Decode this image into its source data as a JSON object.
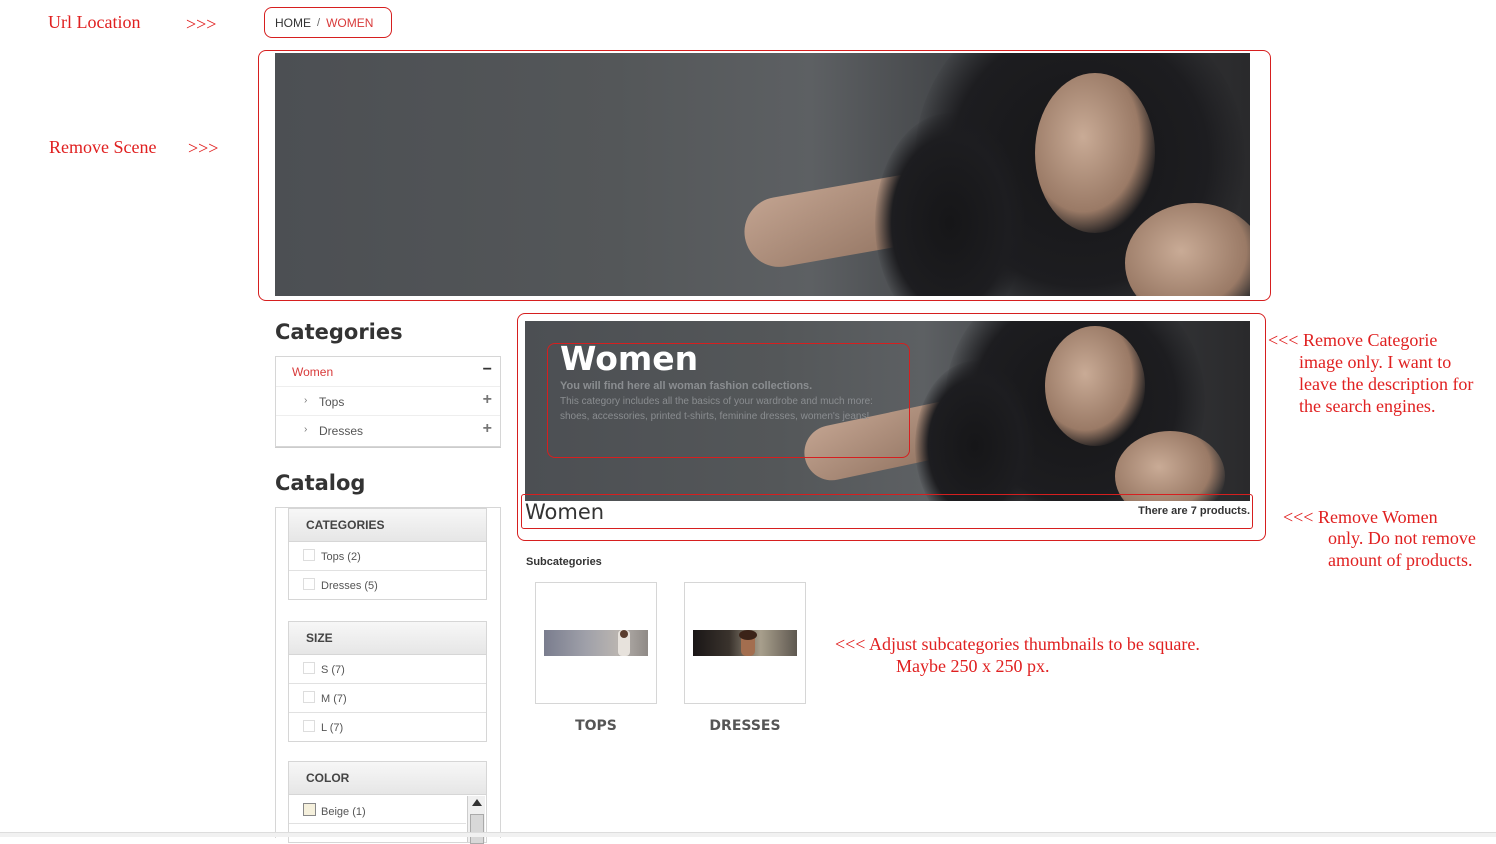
{
  "annotations": {
    "url_location": "Url Location",
    "url_arrow": ">>>",
    "remove_scene": "Remove Scene",
    "scene_arrow": ">>>",
    "remove_category_image": [
      "<<<   Remove Categorie",
      "image only. I want to",
      "leave the description for",
      "the search engines."
    ],
    "remove_women": [
      "<<<   Remove Women",
      "only. Do not remove",
      "amount of products."
    ],
    "adjust_thumbs": [
      "<<<    Adjust subcategories thumbnails to be square.",
      "Maybe 250 x 250 px."
    ]
  },
  "breadcrumb": {
    "home": "HOME",
    "separator": "/",
    "current": "WOMEN"
  },
  "sidebar": {
    "categories_title": "Categories",
    "categories": [
      {
        "label": "Women",
        "toggle": "−",
        "active": true
      },
      {
        "label": "Tops",
        "toggle": "+"
      },
      {
        "label": "Dresses",
        "toggle": "+"
      }
    ],
    "catalog_title": "Catalog",
    "facets": [
      {
        "title": "CATEGORIES",
        "items": [
          "Tops (2)",
          "Dresses (5)"
        ]
      },
      {
        "title": "SIZE",
        "items": [
          "S (7)",
          "M (7)",
          "L (7)"
        ]
      },
      {
        "title": "COLOR",
        "items": [
          "Beige (1)"
        ]
      }
    ]
  },
  "category": {
    "title": "Women",
    "desc_bold": "You will find here all woman fashion collections.",
    "desc_line1": "This category includes all the basics of your wardrobe and much more:",
    "desc_line2": "shoes, accessories, printed t-shirts, feminine dresses, women's jeans!",
    "heading": "Women",
    "product_count": "There are 7 products."
  },
  "subcategories": {
    "title": "Subcategories",
    "items": [
      {
        "label": "TOPS"
      },
      {
        "label": "DRESSES"
      }
    ]
  },
  "colors": {
    "accent_red": "#d61f1f",
    "link_red": "#d83a3a"
  }
}
